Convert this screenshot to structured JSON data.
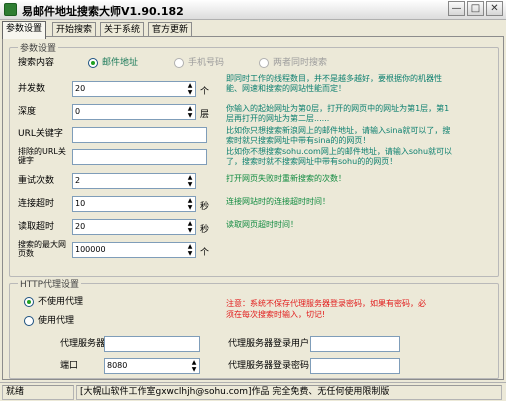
{
  "window": {
    "title": "易邮件地址搜索大师V1.90.182",
    "controls": {
      "minimize": "—",
      "maximize": "□",
      "close": "✕"
    }
  },
  "tabs": [
    {
      "label": "参数设置",
      "active": true
    },
    {
      "label": "开始搜索",
      "active": false
    },
    {
      "label": "关于系统",
      "active": false
    },
    {
      "label": "官方更新",
      "active": false
    }
  ],
  "params": {
    "group_title": "参数设置",
    "search_content_label": "搜索内容",
    "search_options": [
      {
        "label": "邮件地址",
        "checked": true,
        "disabled": false
      },
      {
        "label": "手机号码",
        "checked": false,
        "disabled": true
      },
      {
        "label": "两者同时搜索",
        "checked": false,
        "disabled": true
      }
    ],
    "fields": {
      "concurrency": {
        "label": "并发数",
        "value": "20",
        "unit": "个"
      },
      "depth": {
        "label": "深度",
        "value": "0",
        "unit": "层"
      },
      "url_keyword": {
        "label": "URL关键字",
        "value": ""
      },
      "exclude_url_keyword": {
        "label": "排除的URL关键字",
        "value": ""
      },
      "retry": {
        "label": "重试次数",
        "value": "2"
      },
      "connect_timeout": {
        "label": "连接超时",
        "value": "10",
        "unit": "秒"
      },
      "read_timeout": {
        "label": "读取超时",
        "value": "20",
        "unit": "秒"
      },
      "max_pages": {
        "label": "搜索的最大网页数",
        "value": "100000",
        "unit": "个"
      }
    },
    "help": {
      "concurrency": "即同时工作的线程数目，并不是越多越好，要根据你的机器性能、网速和搜索的网站性能而定！",
      "depth": "你输入的起始网址为第0层，打开的网页中的网址为第1层，第1层再打开的网址为第二层......",
      "url_keyword": "比如你只想搜索新浪网上的邮件地址，请输入sina就可以了，搜索时就只搜索网址中带有sina的的网页！",
      "exclude_url_keyword": "比如你不想搜索sohu.com网上的邮件地址，请输入sohu就可以了，搜索时就不搜索网址中带有sohu的的网页！",
      "retry": "打开网页失败时重新搜索的次数！",
      "connect_timeout": "连接网站时的连接超时时间！",
      "read_timeout": "读取网页超时时间！"
    }
  },
  "proxy": {
    "group_title": "HTTP代理设置",
    "options": [
      {
        "label": "不使用代理",
        "checked": true
      },
      {
        "label": "使用代理",
        "checked": false
      }
    ],
    "warning": "注意：系统不保存代理服务器登录密码，如果有密码，必须在每次搜索时输入，切记!",
    "server_label": "代理服务器",
    "server_value": "",
    "port_label": "端口",
    "port_value": "8080",
    "user_label": "代理服务器登录用户",
    "user_value": "",
    "password_label": "代理服务器登录密码",
    "password_value": ""
  },
  "status": {
    "state": "就绪",
    "credit": "[大幌山软件工作室gxwclhjh@sohu.com]作品   完全免费、无任何使用限制版"
  },
  "colors": {
    "help_text": "#0b7f6f",
    "warning_text": "#e21b1b",
    "window_bg": "#ece9d8"
  }
}
